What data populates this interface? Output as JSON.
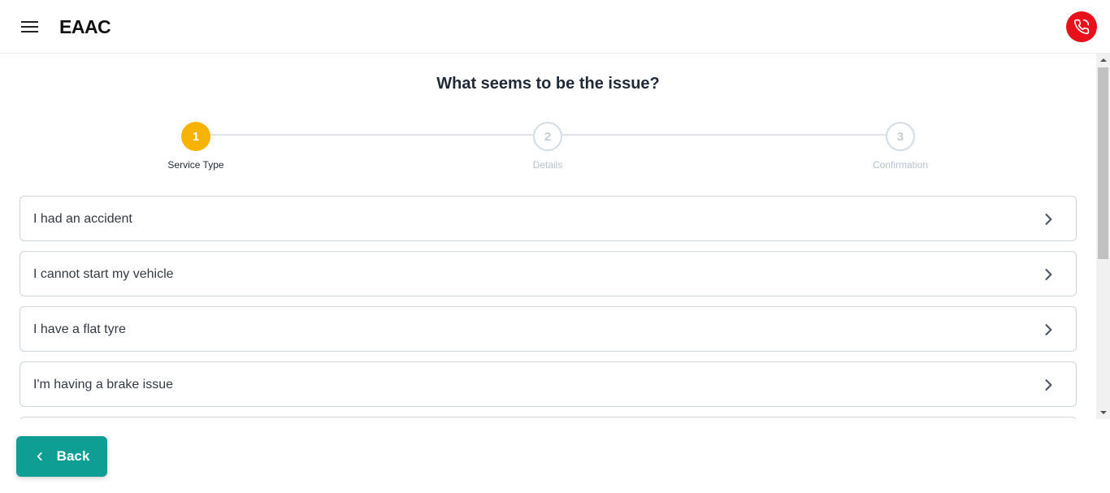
{
  "header": {
    "logo": "EAAC",
    "menu_icon": "hamburger-menu-icon",
    "call_icon": "phone-icon",
    "call_color": "#e8101b"
  },
  "page": {
    "title": "What seems to be the issue?"
  },
  "stepper": {
    "accent": "#f8b200",
    "steps": [
      {
        "number": "1",
        "label": "Service Type",
        "state": "active"
      },
      {
        "number": "2",
        "label": "Details",
        "state": "inactive"
      },
      {
        "number": "3",
        "label": "Confirmation",
        "state": "inactive"
      }
    ]
  },
  "options": [
    {
      "label": "I had an accident"
    },
    {
      "label": "I cannot start my vehicle"
    },
    {
      "label": "I have a flat tyre"
    },
    {
      "label": "I'm having a brake issue"
    }
  ],
  "footer": {
    "back_label": "Back",
    "back_color": "#0e9e93"
  }
}
